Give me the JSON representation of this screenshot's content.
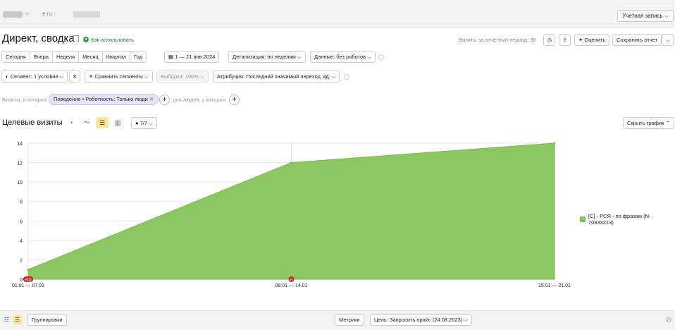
{
  "topbar": {
    "domain": "e ru ·",
    "account_button": "Учетная запись ⌵"
  },
  "header": {
    "title": "Директ, сводка",
    "howto": "Как использовать",
    "visits_label": "Визиты за отчётный период: 38",
    "rate_button": "Оценить",
    "save_report": "Сохранить отчет"
  },
  "period": {
    "items": [
      "Сегодня",
      "Вчера",
      "Неделя",
      "Месяц",
      "Квартал",
      "Год"
    ],
    "date_range": "1 — 21 янв 2024",
    "detail": "Детализация: по неделям ⌵",
    "data": "Данные: без роботов ⌵"
  },
  "segments": {
    "segment": "Сегмент: 1 условие ⌵",
    "compare": "Сравнить сегменты ⌵",
    "sample": "Выборка: 100% ⌵",
    "attribution": "Атрибуция: Последний значимый переход",
    "attribution_tag": "кд"
  },
  "filters": {
    "visits_label": "Визиты, в которых",
    "chip": "Поведение • Роботность: Только люди",
    "people_label": "для людей, у которых"
  },
  "chart_section": {
    "title": "Целевые визиты",
    "comments": "7/7",
    "hide_chart": "Скрыть график ⌃"
  },
  "chart_data": {
    "type": "area",
    "categories": [
      "01.01 — 07.01",
      "08.01 — 14.01",
      "15.01 — 21.01"
    ],
    "series": [
      {
        "name": "[С] - РСЯ - по фразам (N-70833213)",
        "values": [
          1,
          12,
          14
        ],
        "color": "#8dc763"
      }
    ],
    "ylim": [
      0,
      14
    ],
    "yticks": [
      "0",
      "2",
      "4",
      "6",
      "8",
      "10",
      "12",
      "14"
    ],
    "grid": true,
    "legend": "right",
    "annotations": [
      "н)))",
      "н"
    ]
  },
  "bottombar": {
    "groupings": "Группировки",
    "metrics": "Метрики",
    "goal": "Цель: Запросить прайс (24.08.2023) ⌵"
  }
}
